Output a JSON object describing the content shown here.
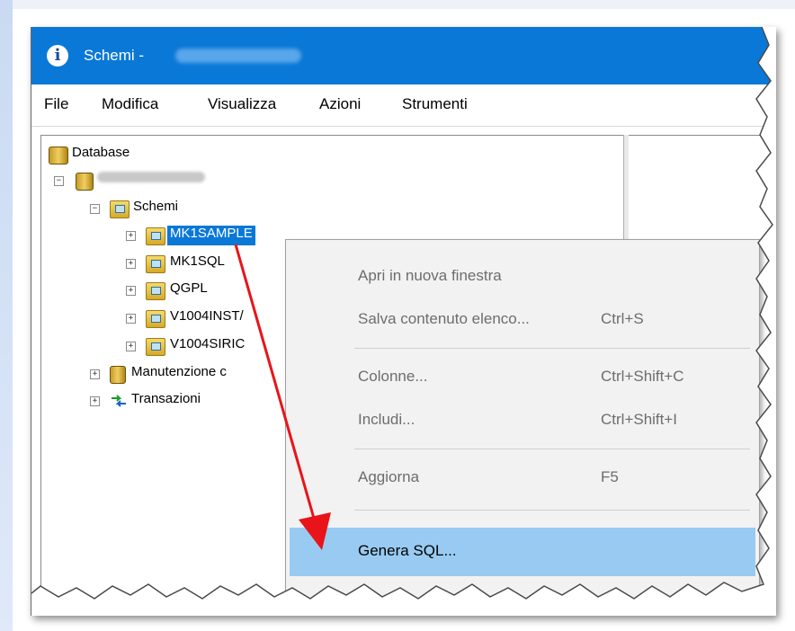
{
  "window": {
    "title": "Schemi -",
    "app_icon": "info-app-icon"
  },
  "menubar": {
    "items": [
      "File",
      "Modifica",
      "Visualizza",
      "Azioni",
      "Strumenti"
    ]
  },
  "tree": {
    "root": "Database",
    "schemi_label": "Schemi",
    "schemas": [
      "MK1SAMPLE",
      "MK1SQL",
      "QGPL",
      "V1004INST/",
      "V1004SIRIC"
    ],
    "selected": "MK1SAMPLE",
    "manutenzione_label": "Manutenzione c",
    "transazioni_label": "Transazioni"
  },
  "context_menu": {
    "items": [
      {
        "label": "Apri in nuova finestra",
        "shortcut": ""
      },
      {
        "label": "Salva contenuto elenco...",
        "shortcut": "Ctrl+S"
      },
      {
        "label": "Colonne...",
        "shortcut": "Ctrl+Shift+C"
      },
      {
        "label": "Includi...",
        "shortcut": "Ctrl+Shift+I"
      },
      {
        "label": "Aggiorna",
        "shortcut": "F5"
      },
      {
        "label": "Genera SQL...",
        "shortcut": ""
      }
    ],
    "highlighted": "Genera SQL..."
  },
  "colors": {
    "titlebar": "#0a78d7",
    "selection": "#0a78d7",
    "menu_highlight": "#99cbf2",
    "arrow": "#e8141a"
  }
}
